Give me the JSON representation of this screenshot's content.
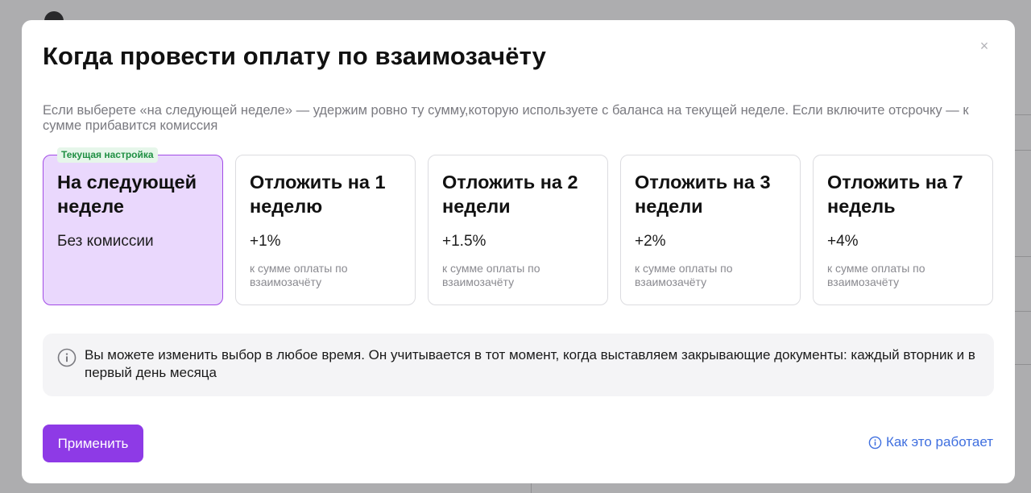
{
  "dialog": {
    "title": "Когда провести оплату по взаимозачёту",
    "subtitle": "Если выберете «на следующей неделе» — удержим ровно ту сумму,которую используете с баланса на текущей неделе. Если включите отсрочку — к сумме прибавится комиссия",
    "close_icon": "close-icon",
    "current_badge": "Текущая настройка",
    "options": [
      {
        "title": "На следующей неделе",
        "rate": "Без комиссии",
        "note": "",
        "selected": true
      },
      {
        "title": "Отложить на 1 неделю",
        "rate": "+1%",
        "note": "к сумме оплаты по взаимозачёту",
        "selected": false
      },
      {
        "title": "Отложить на 2 недели",
        "rate": "+1.5%",
        "note": "к сумме оплаты по взаимозачёту",
        "selected": false
      },
      {
        "title": "Отложить на 3 недели",
        "rate": "+2%",
        "note": "к сумме оплаты по взаимозачёту",
        "selected": false
      },
      {
        "title": "Отложить на 7 недель",
        "rate": "+4%",
        "note": "к сумме оплаты по взаимозачёту",
        "selected": false
      }
    ],
    "info": {
      "icon": "info-icon",
      "text": "Вы можете изменить выбор в любое время. Он учитывается в тот момент, когда выставляем закрывающие документы: каждый вторник и в первый день месяца"
    },
    "apply_label": "Применить",
    "how_it_works_label": "Как это работает"
  },
  "colors": {
    "accent": "#8e3ae6",
    "selected_bg": "#ead8fd",
    "selected_border": "#a24be6",
    "badge_text": "#1f8f43",
    "badge_bg": "#e6f6ea",
    "link": "#3f6fdf"
  }
}
